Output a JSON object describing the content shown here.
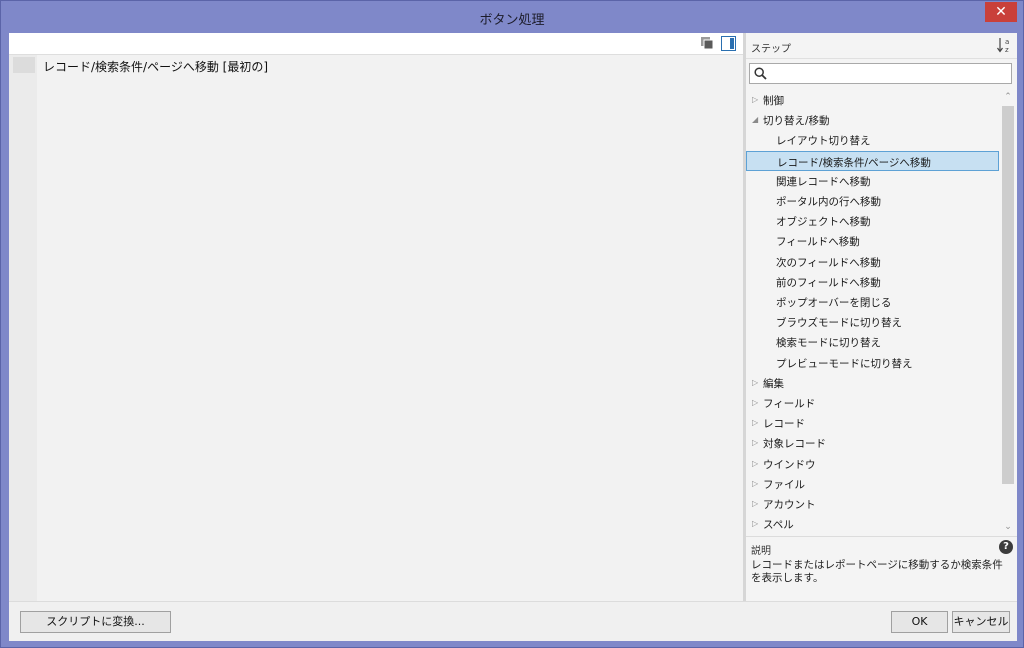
{
  "window": {
    "title": "ボタン処理",
    "close_label": "✕"
  },
  "script": {
    "lines": [
      "レコード/検索条件/ページへ移動 [最初の]"
    ]
  },
  "steps_panel": {
    "title": "ステップ",
    "sort_label": "↓a z",
    "search": {
      "value": "",
      "placeholder": ""
    },
    "tree": [
      {
        "type": "cat",
        "label": "制御",
        "expanded": false
      },
      {
        "type": "cat",
        "label": "切り替え/移動",
        "expanded": true
      },
      {
        "type": "item",
        "label": "レイアウト切り替え"
      },
      {
        "type": "item",
        "label": "レコード/検索条件/ページへ移動",
        "selected": true
      },
      {
        "type": "item",
        "label": "関連レコードへ移動"
      },
      {
        "type": "item",
        "label": "ポータル内の行へ移動"
      },
      {
        "type": "item",
        "label": "オブジェクトへ移動"
      },
      {
        "type": "item",
        "label": "フィールドへ移動"
      },
      {
        "type": "item",
        "label": "次のフィールドへ移動"
      },
      {
        "type": "item",
        "label": "前のフィールドへ移動"
      },
      {
        "type": "item",
        "label": "ポップオーバーを閉じる"
      },
      {
        "type": "item",
        "label": "ブラウズモードに切り替え"
      },
      {
        "type": "item",
        "label": "検索モードに切り替え"
      },
      {
        "type": "item",
        "label": "プレビューモードに切り替え"
      },
      {
        "type": "cat",
        "label": "編集",
        "expanded": false
      },
      {
        "type": "cat",
        "label": "フィールド",
        "expanded": false
      },
      {
        "type": "cat",
        "label": "レコード",
        "expanded": false
      },
      {
        "type": "cat",
        "label": "対象レコード",
        "expanded": false
      },
      {
        "type": "cat",
        "label": "ウインドウ",
        "expanded": false
      },
      {
        "type": "cat",
        "label": "ファイル",
        "expanded": false
      },
      {
        "type": "cat",
        "label": "アカウント",
        "expanded": false
      },
      {
        "type": "cat",
        "label": "スペル",
        "expanded": false
      }
    ]
  },
  "description": {
    "title": "説明",
    "help_label": "?",
    "text": "レコードまたはレポートページに移動するか検索条件を表示します。"
  },
  "buttons": {
    "convert": "スクリプトに変換...",
    "ok": "OK",
    "cancel": "キャンセル"
  },
  "colors": {
    "titlebar": "#7f88c9",
    "close": "#c9403a",
    "selection": "#c7e0f2"
  }
}
